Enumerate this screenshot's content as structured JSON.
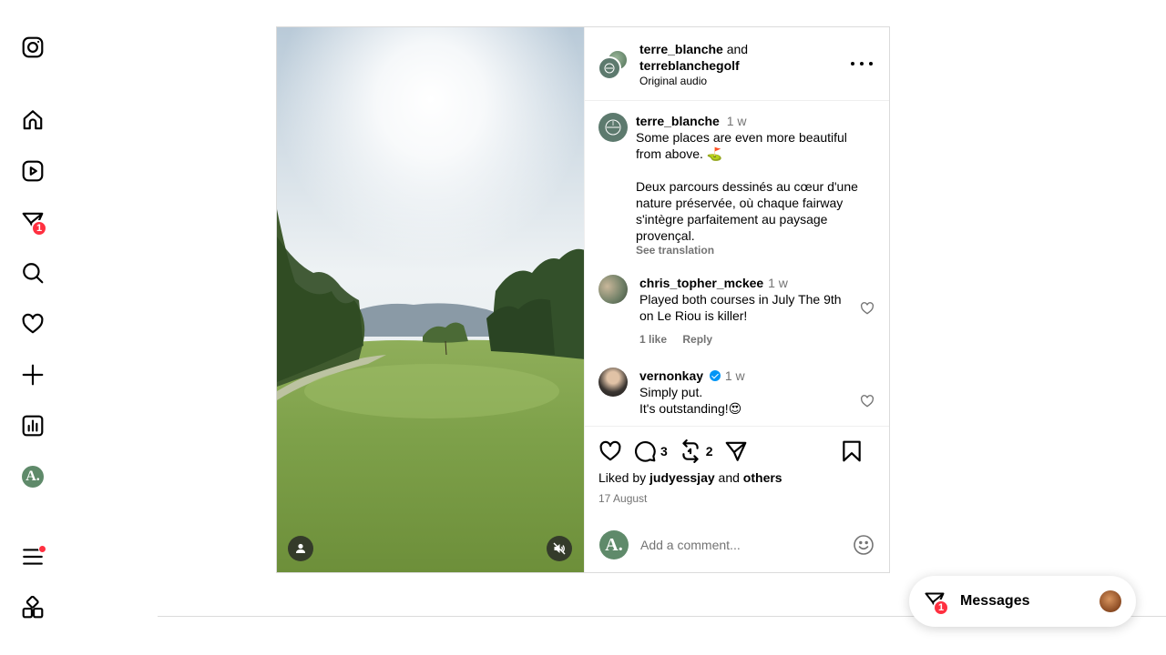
{
  "nav": {
    "items": [
      {
        "icon": "instagram-logo-icon"
      },
      {
        "icon": "home-icon"
      },
      {
        "icon": "reels-icon"
      },
      {
        "icon": "direct-messages-icon",
        "badge": "1"
      },
      {
        "icon": "search-icon"
      },
      {
        "icon": "notifications-heart-icon"
      },
      {
        "icon": "create-plus-icon"
      },
      {
        "icon": "dashboard-icon"
      },
      {
        "icon": "profile-avatar-icon",
        "letter": "A."
      },
      {
        "icon": "more-menu-icon",
        "dot": true
      },
      {
        "icon": "also-from-meta-icon"
      }
    ]
  },
  "post": {
    "header": {
      "author1": "terre_blanche",
      "joiner": "and",
      "author2": "terreblanchegolf",
      "audio": "Original audio"
    },
    "caption": {
      "username": "terre_blanche",
      "time": "1 w",
      "line1": "Some places are even more beautiful from above. ⛳",
      "line2": "Deux parcours dessinés au cœur d'une nature préservée, où chaque fairway s'intègre parfaitement au paysage provençal.",
      "see_translation": "See translation"
    },
    "comments": [
      {
        "username": "chris_topher_mckee",
        "time": "1 w",
        "text": "Played both courses in July The 9th on Le Riou is killer!",
        "likes": "1 like",
        "reply": "Reply"
      },
      {
        "username": "vernonkay",
        "verified": true,
        "time": "1 w",
        "text_line1": "Simply put.",
        "text_line2": "It's outstanding!😍"
      }
    ],
    "actions": {
      "comment_count": "3",
      "repost_count": "2"
    },
    "liked_by": {
      "prefix": "Liked by",
      "user": "judyessjay",
      "joiner": "and",
      "others": "others"
    },
    "date": "17 August",
    "add_comment": {
      "avatar_letter": "A.",
      "placeholder": "Add a comment..."
    }
  },
  "messages": {
    "label": "Messages",
    "badge": "1"
  },
  "colors": {
    "badge": "#ff3040",
    "verified": "#0095f6",
    "muted_text": "#737373",
    "profile_green": "#5f8a6a"
  }
}
